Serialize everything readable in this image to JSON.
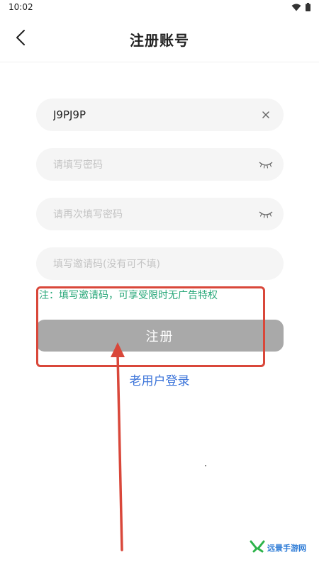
{
  "status_bar": {
    "time": "10:02"
  },
  "header": {
    "title": "注册账号"
  },
  "form": {
    "username_value": "J9PJ9P",
    "password_placeholder": "请填写密码",
    "confirm_placeholder": "请再次填写密码",
    "invite_placeholder": "填写邀请码(没有可不填)",
    "note": "注：填写邀请码，可享受限时无广告特权",
    "register_label": "注册",
    "login_link": "老用户登录"
  },
  "watermark": {
    "text": "远景手游网"
  },
  "colors": {
    "accent_note": "#2aa87a",
    "link": "#3a73d9",
    "button_disabled": "#a9a9a9",
    "annotation": "#d9473a"
  }
}
